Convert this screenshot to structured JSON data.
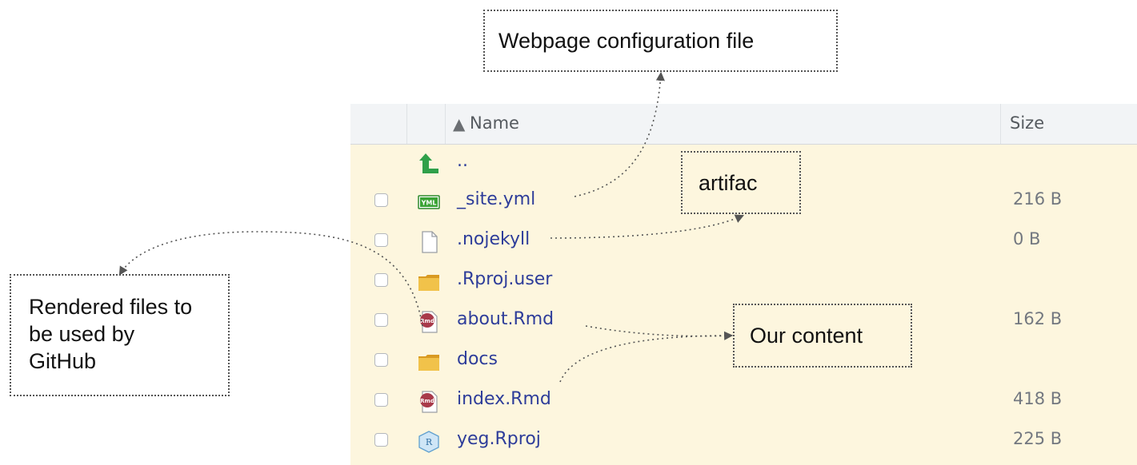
{
  "header": {
    "sort_indicator": "▲",
    "name_label": "Name",
    "size_label": "Size"
  },
  "files": [
    {
      "name": "..",
      "size": "",
      "icon": "up-arrow-icon"
    },
    {
      "name": "_site.yml",
      "size": "216 B",
      "icon": "yml-file-icon"
    },
    {
      "name": ".nojekyll",
      "size": "0 B",
      "icon": "blank-file-icon"
    },
    {
      "name": ".Rproj.user",
      "size": "",
      "icon": "folder-icon"
    },
    {
      "name": "about.Rmd",
      "size": "162 B",
      "icon": "rmd-file-icon"
    },
    {
      "name": "docs",
      "size": "",
      "icon": "folder-icon"
    },
    {
      "name": "index.Rmd",
      "size": "418 B",
      "icon": "rmd-file-icon"
    },
    {
      "name": "yeg.Rproj",
      "size": "225 B",
      "icon": "rproj-file-icon"
    }
  ],
  "annotations": {
    "config": "Webpage configuration file",
    "artifact": "artifac",
    "content": "Our content",
    "rendered_line1": "Rendered files to",
    "rendered_line2": "be used by",
    "rendered_line3": "GitHub"
  },
  "colors": {
    "pane_background": "#fdf6de",
    "header_background": "#f2f4f6",
    "file_link": "#2e3d9a",
    "size_text": "#737880",
    "up_arrow": "#2fa04a",
    "yml_badge": "#3aa335",
    "folder": "#e9b33c",
    "rmd_badge": "#a83a4a",
    "rproj_badge": "#7fb6dd"
  }
}
